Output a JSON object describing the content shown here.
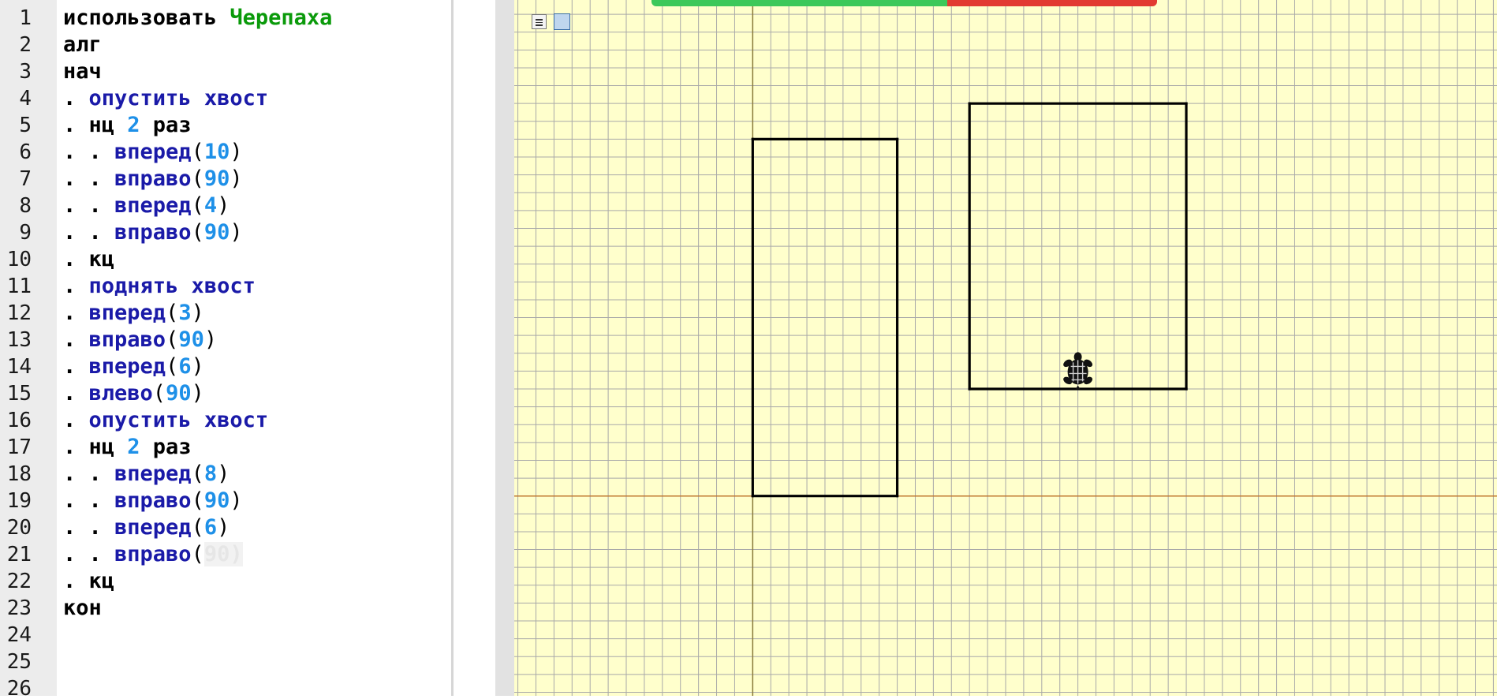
{
  "editor": {
    "line_numbers": [
      "1",
      "2",
      "3",
      "4",
      "5",
      "6",
      "7",
      "8",
      "9",
      "10",
      "11",
      "12",
      "13",
      "14",
      "15",
      "16",
      "17",
      "18",
      "19",
      "20",
      "21",
      "22",
      "23",
      "24",
      "25",
      "26"
    ],
    "lines": [
      [
        {
          "t": "использовать ",
          "c": "kw"
        },
        {
          "t": "Черепаха",
          "c": "ident"
        }
      ],
      [
        {
          "t": "алг",
          "c": "kw"
        }
      ],
      [
        {
          "t": "нач",
          "c": "kw"
        }
      ],
      [
        {
          "t": ". ",
          "c": "kw"
        },
        {
          "t": "опустить хвост",
          "c": "cmd"
        }
      ],
      [
        {
          "t": ". нц ",
          "c": "kw"
        },
        {
          "t": "2",
          "c": "num"
        },
        {
          "t": " раз",
          "c": "kw"
        }
      ],
      [
        {
          "t": ". . ",
          "c": "kw"
        },
        {
          "t": "вперед",
          "c": "cmd"
        },
        {
          "t": "(",
          "c": "paren"
        },
        {
          "t": "10",
          "c": "num"
        },
        {
          "t": ")",
          "c": "paren"
        }
      ],
      [
        {
          "t": ". . ",
          "c": "kw"
        },
        {
          "t": "вправо",
          "c": "cmd"
        },
        {
          "t": "(",
          "c": "paren"
        },
        {
          "t": "90",
          "c": "num"
        },
        {
          "t": ")",
          "c": "paren"
        }
      ],
      [
        {
          "t": ". . ",
          "c": "kw"
        },
        {
          "t": "вперед",
          "c": "cmd"
        },
        {
          "t": "(",
          "c": "paren"
        },
        {
          "t": "4",
          "c": "num"
        },
        {
          "t": ")",
          "c": "paren"
        }
      ],
      [
        {
          "t": ". . ",
          "c": "kw"
        },
        {
          "t": "вправо",
          "c": "cmd"
        },
        {
          "t": "(",
          "c": "paren"
        },
        {
          "t": "90",
          "c": "num"
        },
        {
          "t": ")",
          "c": "paren"
        }
      ],
      [
        {
          "t": ". кц",
          "c": "kw"
        }
      ],
      [
        {
          "t": ". ",
          "c": "kw"
        },
        {
          "t": "поднять хвост",
          "c": "cmd"
        }
      ],
      [
        {
          "t": ". ",
          "c": "kw"
        },
        {
          "t": "вперед",
          "c": "cmd"
        },
        {
          "t": "(",
          "c": "paren"
        },
        {
          "t": "3",
          "c": "num"
        },
        {
          "t": ")",
          "c": "paren"
        }
      ],
      [
        {
          "t": ". ",
          "c": "kw"
        },
        {
          "t": "вправо",
          "c": "cmd"
        },
        {
          "t": "(",
          "c": "paren"
        },
        {
          "t": "90",
          "c": "num"
        },
        {
          "t": ")",
          "c": "paren"
        }
      ],
      [
        {
          "t": ". ",
          "c": "kw"
        },
        {
          "t": "вперед",
          "c": "cmd"
        },
        {
          "t": "(",
          "c": "paren"
        },
        {
          "t": "6",
          "c": "num"
        },
        {
          "t": ")",
          "c": "paren"
        }
      ],
      [
        {
          "t": ". ",
          "c": "kw"
        },
        {
          "t": "влево",
          "c": "cmd"
        },
        {
          "t": "(",
          "c": "paren"
        },
        {
          "t": "90",
          "c": "num"
        },
        {
          "t": ")",
          "c": "paren"
        }
      ],
      [
        {
          "t": ". ",
          "c": "kw"
        },
        {
          "t": "опустить хвост",
          "c": "cmd"
        }
      ],
      [
        {
          "t": ". нц ",
          "c": "kw"
        },
        {
          "t": "2",
          "c": "num"
        },
        {
          "t": " раз",
          "c": "kw"
        }
      ],
      [
        {
          "t": ". . ",
          "c": "kw"
        },
        {
          "t": "вперед",
          "c": "cmd"
        },
        {
          "t": "(",
          "c": "paren"
        },
        {
          "t": "8",
          "c": "num"
        },
        {
          "t": ")",
          "c": "paren"
        }
      ],
      [
        {
          "t": ". . ",
          "c": "kw"
        },
        {
          "t": "вправо",
          "c": "cmd"
        },
        {
          "t": "(",
          "c": "paren"
        },
        {
          "t": "90",
          "c": "num"
        },
        {
          "t": ")",
          "c": "paren"
        }
      ],
      [
        {
          "t": ". . ",
          "c": "kw"
        },
        {
          "t": "вперед",
          "c": "cmd"
        },
        {
          "t": "(",
          "c": "paren"
        },
        {
          "t": "6",
          "c": "num"
        },
        {
          "t": ")",
          "c": "paren"
        }
      ],
      [
        {
          "t": ". . ",
          "c": "kw"
        },
        {
          "t": "вправо",
          "c": "cmd"
        },
        {
          "t": "(",
          "c": "paren"
        },
        {
          "t": "90)",
          "c": "ghost"
        }
      ],
      [
        {
          "t": ". кц",
          "c": "kw"
        }
      ],
      [
        {
          "t": "кон",
          "c": "kw"
        }
      ],
      [],
      [],
      []
    ]
  },
  "field": {
    "background_color": "#ffffcc",
    "grid_color": "#a9a9a9",
    "axis_y_color": "#8a7a3a",
    "axis_x_color": "#c07830",
    "path_color": "#000000",
    "turtle_icon": "turtle-icon",
    "turtle_position": {
      "x": 9,
      "y": 3.5
    },
    "segments": [
      [
        [
          0,
          0
        ],
        [
          0,
          10
        ]
      ],
      [
        [
          0,
          10
        ],
        [
          4,
          10
        ]
      ],
      [
        [
          4,
          10
        ],
        [
          4,
          0
        ]
      ],
      [
        [
          4,
          0
        ],
        [
          0,
          0
        ]
      ],
      [
        [
          6,
          3
        ],
        [
          6,
          11
        ]
      ],
      [
        [
          6,
          11
        ],
        [
          12,
          11
        ]
      ],
      [
        [
          12,
          11
        ],
        [
          12,
          3
        ]
      ],
      [
        [
          12,
          3
        ],
        [
          6,
          3
        ]
      ]
    ],
    "x_range": [
      -6.6,
      20.6
    ],
    "y_range": [
      -5.6,
      13.9
    ]
  },
  "toolbar": {
    "menu_icon": "menu-icon",
    "view_icon": "view-square-icon"
  }
}
